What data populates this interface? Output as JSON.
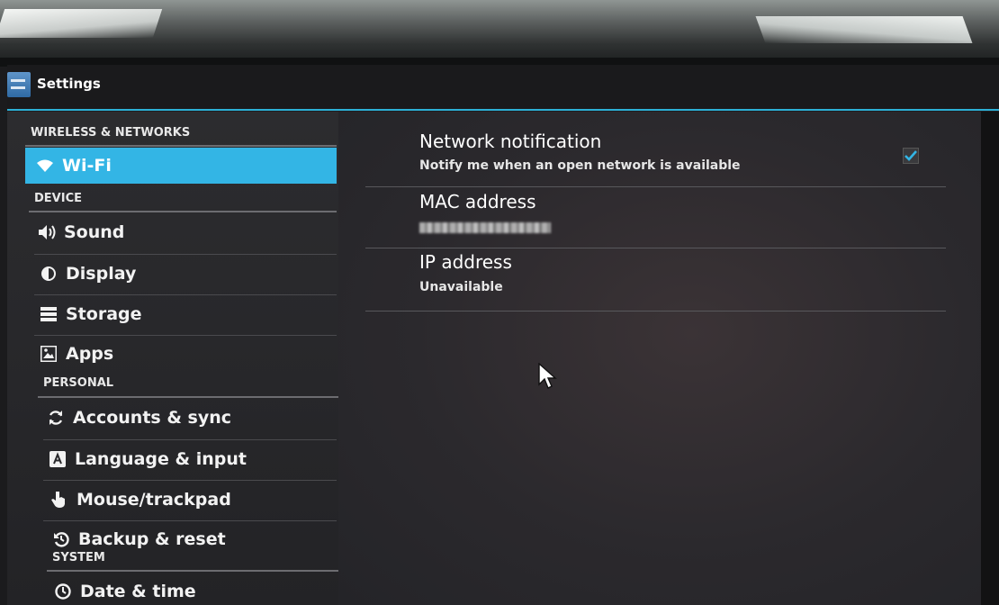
{
  "app": {
    "title": "Settings",
    "icon": "settings-icon"
  },
  "nav": {
    "sections": [
      {
        "header": "WIRELESS & NETWORKS",
        "items": [
          {
            "label": "Wi-Fi",
            "icon": "wifi-icon",
            "selected": true
          }
        ]
      },
      {
        "header": "DEVICE",
        "items": [
          {
            "label": "Sound",
            "icon": "speaker-icon"
          },
          {
            "label": "Display",
            "icon": "brightness-icon"
          },
          {
            "label": "Storage",
            "icon": "storage-icon"
          },
          {
            "label": "Apps",
            "icon": "apps-icon"
          }
        ]
      },
      {
        "header": "PERSONAL",
        "items": [
          {
            "label": "Accounts & sync",
            "icon": "sync-icon"
          },
          {
            "label": "Language & input",
            "icon": "keyboard-icon"
          },
          {
            "label": "Mouse/trackpad",
            "icon": "hand-pointer-icon"
          },
          {
            "label": "Backup & reset",
            "icon": "restore-icon"
          }
        ]
      },
      {
        "header": "SYSTEM",
        "items": [
          {
            "label": "Date & time",
            "icon": "clock-icon"
          }
        ]
      }
    ]
  },
  "detail": {
    "prefs": [
      {
        "title": "Network notification",
        "summary": "Notify me when an open network is available",
        "checked": true
      },
      {
        "title": "MAC address",
        "summary_blurred": true
      },
      {
        "title": "IP address",
        "summary": "Unavailable"
      }
    ]
  },
  "colors": {
    "accent": "#33b5e5",
    "action_bar_line": "#2cb0d6"
  }
}
